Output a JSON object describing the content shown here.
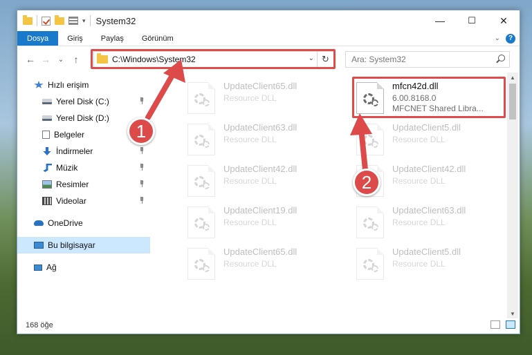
{
  "titlebar": {
    "title": "System32",
    "minimize": "—",
    "maximize": "☐",
    "close": "✕"
  },
  "ribbon": {
    "tabs": [
      {
        "label": "Dosya",
        "active": true
      },
      {
        "label": "Giriş"
      },
      {
        "label": "Paylaş"
      },
      {
        "label": "Görünüm"
      }
    ],
    "expand_glyph": "⌄",
    "help_glyph": "?"
  },
  "navbar": {
    "back": "←",
    "forward": "→",
    "recent": "⌄",
    "up": "↑",
    "address": "C:\\Windows\\System32",
    "address_dropdown": "⌄",
    "refresh": "↻",
    "search_placeholder": "Ara: System32"
  },
  "sidebar": {
    "items": [
      {
        "label": "Hızlı erişim",
        "icon": "star-icon",
        "pinned": false,
        "selected": false,
        "indent": 1
      },
      {
        "label": "Yerel Disk (C:)",
        "icon": "drive-icon",
        "pinned": true,
        "selected": false,
        "indent": 2
      },
      {
        "label": "Yerel Disk (D:)",
        "icon": "drive-icon",
        "pinned": false,
        "selected": false,
        "indent": 2
      },
      {
        "label": "Belgeler",
        "icon": "documents-icon",
        "pinned": false,
        "selected": false,
        "indent": 2
      },
      {
        "label": "İndirmeler",
        "icon": "download-icon",
        "pinned": true,
        "selected": false,
        "indent": 2
      },
      {
        "label": "Müzik",
        "icon": "music-icon",
        "pinned": true,
        "selected": false,
        "indent": 2
      },
      {
        "label": "Resimler",
        "icon": "pictures-icon",
        "pinned": true,
        "selected": false,
        "indent": 2
      },
      {
        "label": "Videolar",
        "icon": "videos-icon",
        "pinned": true,
        "selected": false,
        "indent": 2
      },
      {
        "label": "",
        "icon": "",
        "spacer": true
      },
      {
        "label": "OneDrive",
        "icon": "cloud-icon",
        "pinned": false,
        "selected": false,
        "indent": 1
      },
      {
        "label": "",
        "icon": "",
        "spacer": true
      },
      {
        "label": "Bu bilgisayar",
        "icon": "computer-icon",
        "pinned": false,
        "selected": true,
        "indent": 1
      },
      {
        "label": "",
        "icon": "",
        "spacer": true
      },
      {
        "label": "Ağ",
        "icon": "network-icon",
        "pinned": false,
        "selected": false,
        "indent": 1
      }
    ]
  },
  "files": [
    {
      "name": "UpdateClient65.dll",
      "type": "Resource DLL",
      "ghost": true,
      "col": 0,
      "row": 0
    },
    {
      "name": "mfcn42d.dll",
      "version": "6.00.8168.0",
      "type": "MFCNET Shared Libra...",
      "ghost": false,
      "col": 1,
      "row": 0
    },
    {
      "name": "UpdateClient63.dll",
      "type": "Resource DLL",
      "ghost": true,
      "col": 0,
      "row": 1
    },
    {
      "name": "UpdateClient5.dll",
      "type": "Resource DLL",
      "ghost": true,
      "col": 1,
      "row": 1
    },
    {
      "name": "UpdateClient42.dll",
      "type": "Resource DLL",
      "ghost": true,
      "col": 0,
      "row": 2
    },
    {
      "name": "UpdateClient42.dll",
      "type": "Resource DLL",
      "ghost": true,
      "col": 1,
      "row": 2
    },
    {
      "name": "UpdateClient19.dll",
      "type": "Resource DLL",
      "ghost": true,
      "col": 0,
      "row": 3
    },
    {
      "name": "UpdateClient63.dll",
      "type": "Resource DLL",
      "ghost": true,
      "col": 1,
      "row": 3
    },
    {
      "name": "UpdateClient65.dll",
      "type": "Resource DLL",
      "ghost": true,
      "col": 0,
      "row": 4
    },
    {
      "name": "UpdateClient5.dll",
      "type": "Resource DLL",
      "ghost": true,
      "col": 1,
      "row": 4
    }
  ],
  "statusbar": {
    "count": "168 öğe"
  },
  "annotations": {
    "badge1": "1",
    "badge2": "2",
    "color": "#dd4a4a"
  },
  "colors": {
    "accent": "#1979ca",
    "selected_bg": "#cce8ff",
    "highlight": "#e04a4a"
  }
}
